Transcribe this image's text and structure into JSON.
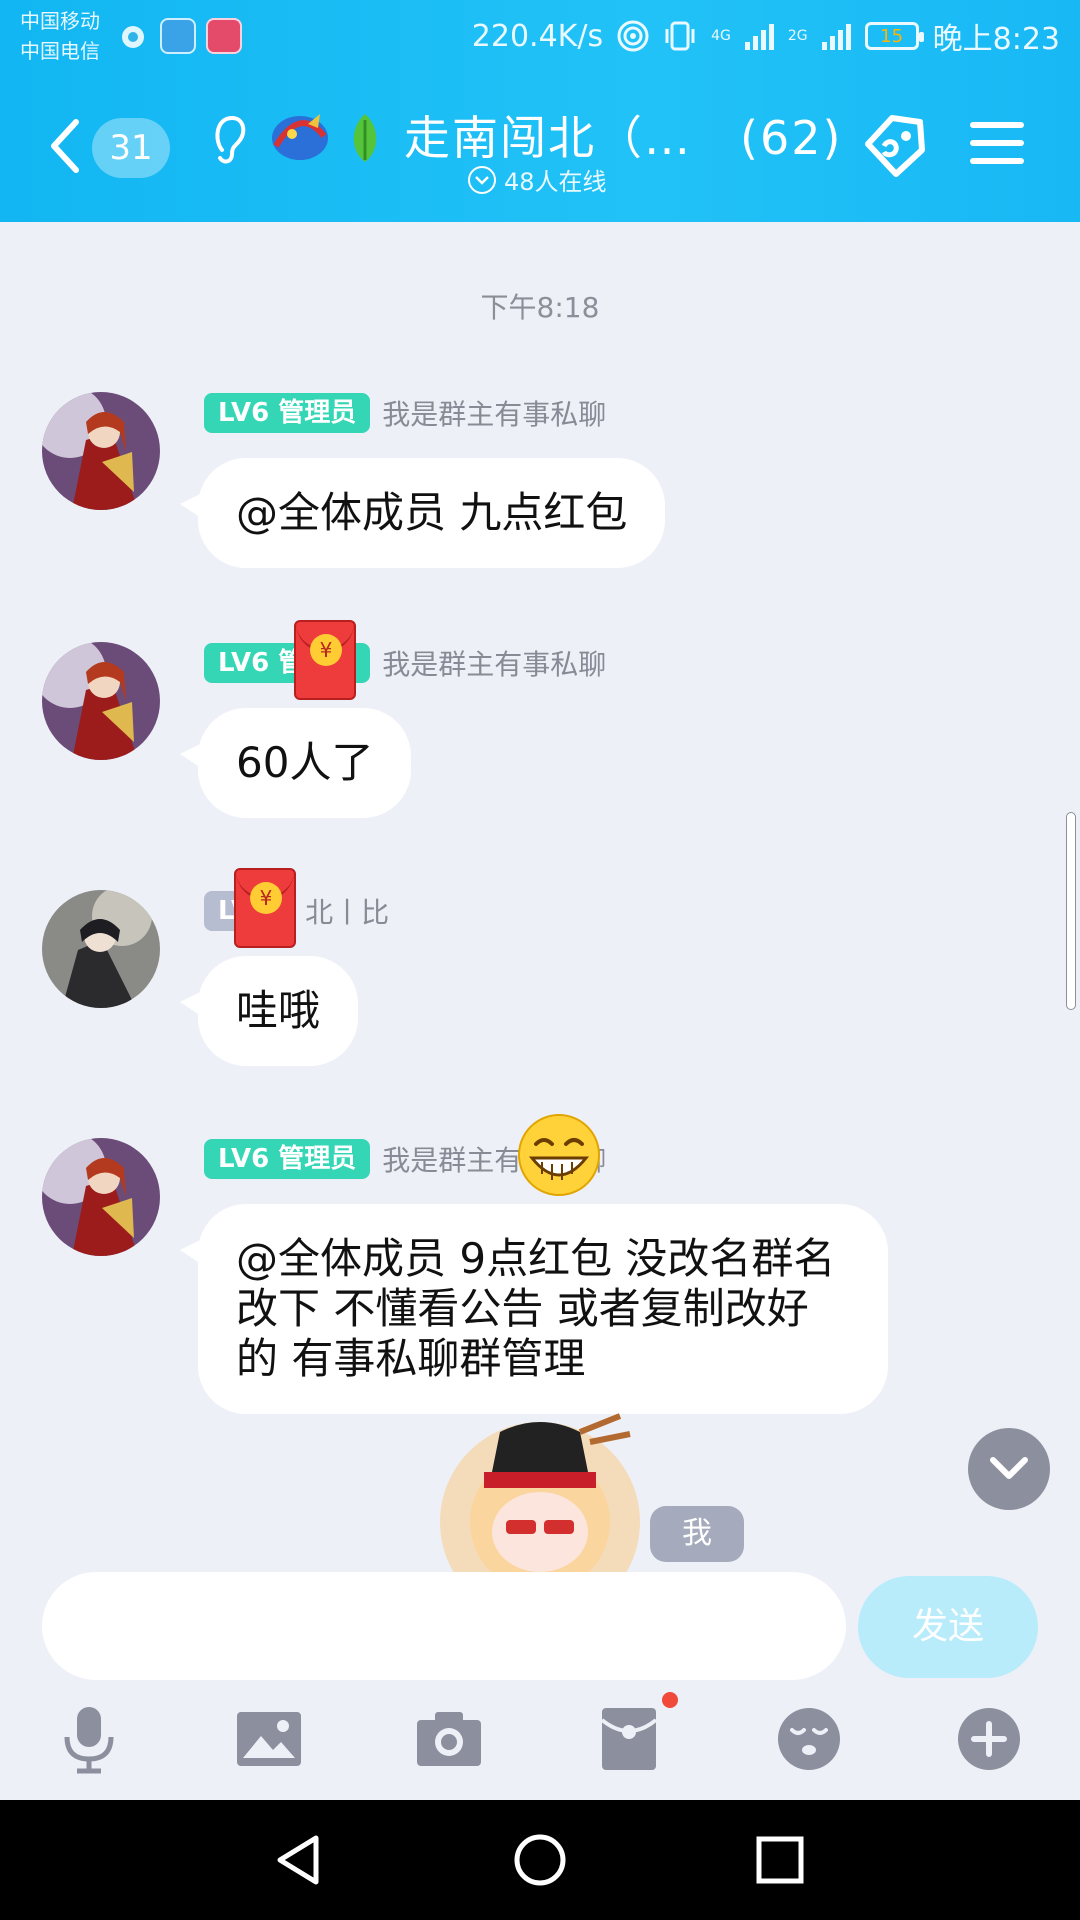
{
  "status_bar": {
    "carrier1": "中国移动",
    "carrier2": "中国电信",
    "net_speed": "220.4K/s",
    "net_4g": "4G",
    "net_2g": "2G",
    "battery": "15",
    "time": "晚上8:23"
  },
  "header": {
    "unread_count": "31",
    "group_name": "走南闯北（…",
    "member_count": "(62)",
    "online": "48人在线"
  },
  "chat": {
    "timestamp": "下午8:18",
    "messages": [
      {
        "level": "LV6 管理员",
        "nick": "我是群主有事私聊",
        "text": "@全体成员  九点红包"
      },
      {
        "level": "LV6 管理员",
        "nick": "我是群主有事私聊",
        "text": "60人了"
      },
      {
        "level": "LV",
        "nick": "北丨比",
        "text": "哇哦"
      },
      {
        "level": "LV6 管理员",
        "nick": "我是群主有事私聊",
        "text": "@全体成员  9点红包  没改名群名改下  不懂看公告  或者复制改好的  有事私聊群管理"
      }
    ],
    "me_label": "我"
  },
  "input": {
    "placeholder": "",
    "send_label": "发送"
  },
  "colors": {
    "header": "#1ab9f4",
    "admin_badge": "#35d6b5",
    "send_button": "#b8ecfb"
  },
  "icons": [
    "back-icon",
    "ear-icon",
    "dragon-badge-icon",
    "leaf-icon",
    "tag-icon",
    "menu-icon",
    "mic-icon",
    "image-icon",
    "camera-icon",
    "redpacket-icon",
    "emoji-icon",
    "plus-icon",
    "chevron-down-icon"
  ]
}
